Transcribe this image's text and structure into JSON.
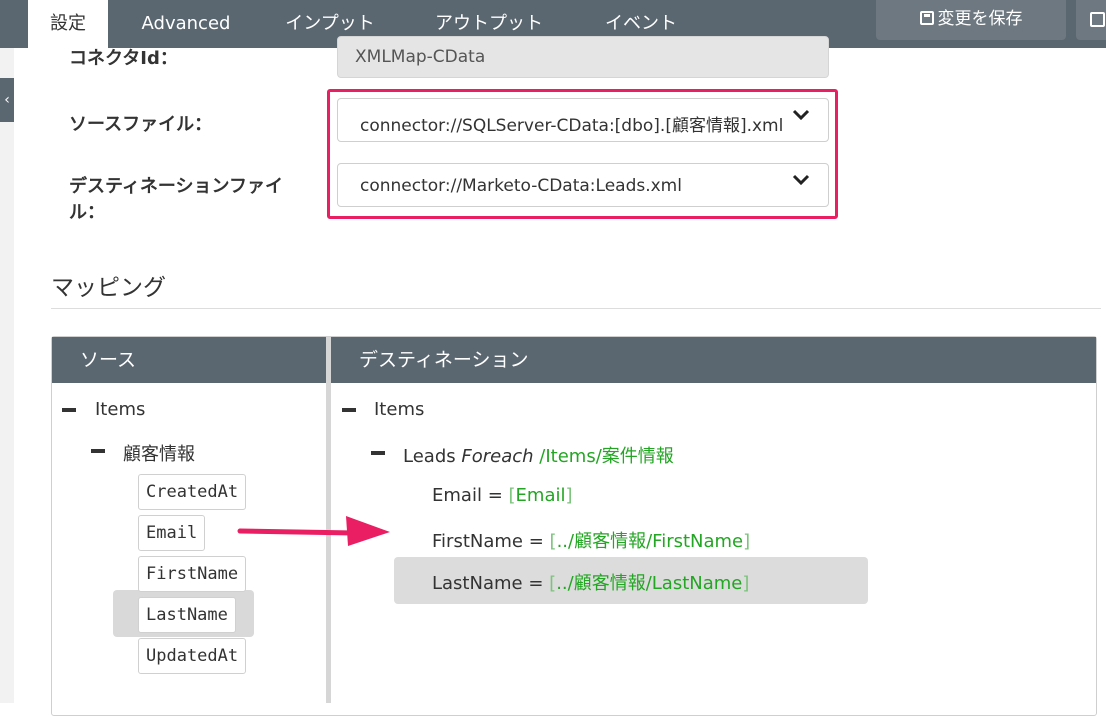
{
  "tabs": [
    "設定",
    "Advanced",
    "インプット",
    "アウトプット",
    "イベント"
  ],
  "toolbar": {
    "save_label": "変更を保存"
  },
  "form": {
    "connector_id_label": "コネクタId：",
    "connector_id_value": "XMLMap-CData",
    "source_label": "ソースファイル：",
    "source_value": "connector://SQLServer-CData:[dbo].[顧客情報].xml",
    "dest_label_line1": "デスティネーションファイ",
    "dest_label_line2": "ル：",
    "dest_value": "connector://Marketo-CData:Leads.xml"
  },
  "mapping": {
    "section_title": "マッピング",
    "source_header": "ソース",
    "dest_header": "デスティネーション",
    "source_tree": {
      "root": "Items",
      "child": "顧客情報",
      "fields": [
        "CreatedAt",
        "Email",
        "FirstName",
        "LastName",
        "UpdatedAt"
      ]
    },
    "dest_tree": {
      "root": "Items",
      "leads_label": "Leads",
      "foreach_label": "Foreach",
      "foreach_path": "/Items/案件情報",
      "rows": [
        {
          "name": "Email",
          "eq": "=",
          "open": "[",
          "path": "Email",
          "close": "]"
        },
        {
          "name": "FirstName",
          "eq": "=",
          "open": "[",
          "path": "../顧客情報/FirstName",
          "close": "]"
        },
        {
          "name": "LastName",
          "eq": "=",
          "open": "[",
          "path": "../顧客情報/LastName",
          "close": "]"
        }
      ]
    }
  },
  "colors": {
    "header": "#5b6770",
    "highlight": "#e91e63",
    "green": "#23a623"
  },
  "icons": {
    "save": "floppy-disk-icon",
    "external": "external-link-icon",
    "chevron": "chevron-down-icon",
    "arrow": "arrow-right-icon"
  }
}
